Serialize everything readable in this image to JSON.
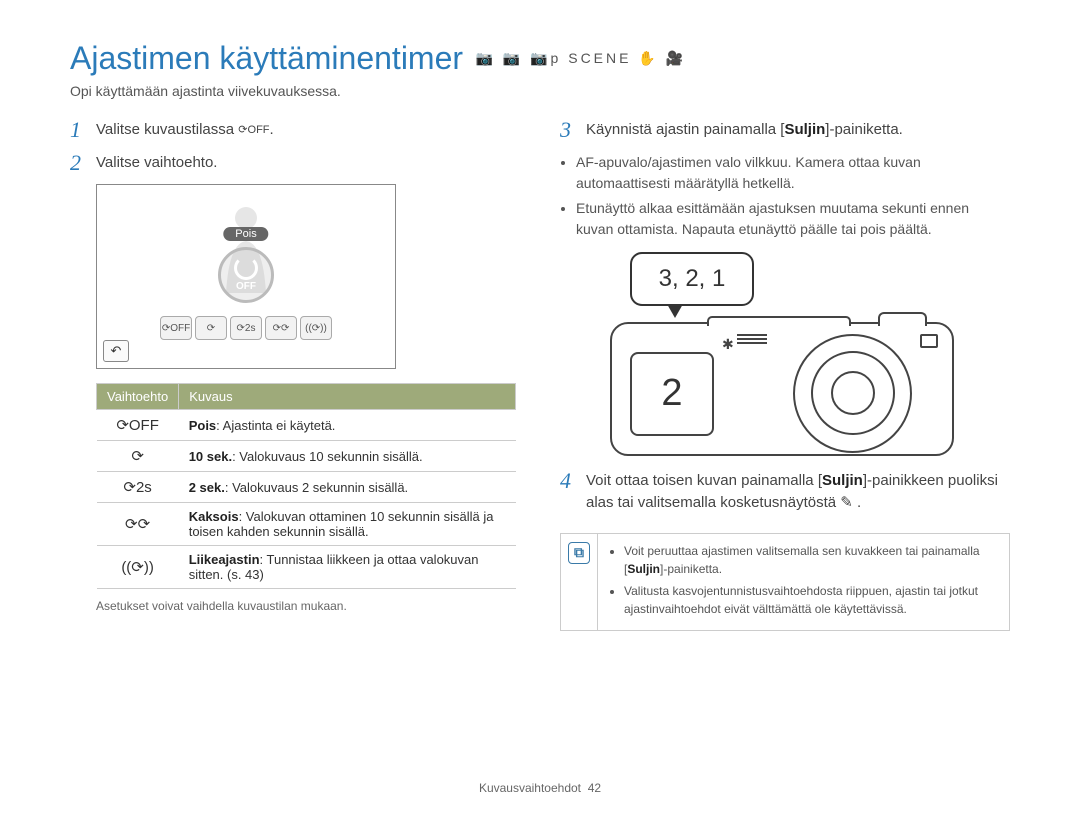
{
  "title": "Ajastimen käyttäminentimer",
  "mode_icons": "📷 📷 📷p SCENE ✋ 🎥",
  "subtitle": "Opi käyttämään ajastinta viivekuvauksessa.",
  "left": {
    "step1_num": "1",
    "step1_text_a": "Valitse kuvaustilassa ",
    "step1_text_b": ".",
    "step1_icon": "⟳OFF",
    "step2_num": "2",
    "step2_text": "Valitse vaihtoehto.",
    "screen": {
      "timer_label": "Pois",
      "options": [
        "⟳OFF",
        "⟳",
        "⟳2s",
        "⟳⟳",
        "((⟳))"
      ],
      "back": "↶"
    },
    "table": {
      "header_option": "Vaihtoehto",
      "header_desc": "Kuvaus",
      "rows": [
        {
          "icon": "⟳OFF",
          "bold": "Pois",
          "text": ": Ajastinta ei käytetä."
        },
        {
          "icon": "⟳",
          "bold": "10 sek.",
          "text": ": Valokuvaus 10 sekunnin sisällä."
        },
        {
          "icon": "⟳2s",
          "bold": "2 sek.",
          "text": ": Valokuvaus 2 sekunnin sisällä."
        },
        {
          "icon": "⟳⟳",
          "bold": "Kaksois",
          "text": ": Valokuvan ottaminen 10 sekunnin sisällä ja toisen kahden sekunnin sisällä."
        },
        {
          "icon": "((⟳))",
          "bold": "Liikeajastin",
          "text": ": Tunnistaa liikkeen ja ottaa valokuvan sitten. (s. 43)"
        }
      ]
    },
    "note": "Asetukset voivat vaihdella kuvaustilan mukaan."
  },
  "right": {
    "step3_num": "3",
    "step3_text_a": "Käynnistä ajastin painamalla [",
    "step3_text_b": "Suljin",
    "step3_text_c": "]-painiketta.",
    "bullets3": [
      "AF-apuvalo/ajastimen valo vilkkuu. Kamera ottaa kuvan automaattisesti määrätyllä hetkellä.",
      "Etunäyttö alkaa esittämään ajastuksen muutama sekunti ennen kuvan ottamista. Napauta etunäyttö päälle tai pois päältä."
    ],
    "bubble": "3, 2, 1",
    "front_screen_number": "2",
    "step4_num": "4",
    "step4_text_a": "Voit ottaa toisen kuvan painamalla [",
    "step4_text_b": "Suljin",
    "step4_text_c": "]-painikkeen puoliksi alas tai valitsemalla kosketusnäytöstä ",
    "step4_icon": "✎",
    "step4_text_d": " .",
    "tips": [
      {
        "a": "Voit peruuttaa ajastimen valitsemalla sen kuvakkeen tai painamalla [",
        "b": "Suljin",
        "c": "]-painiketta."
      },
      {
        "a": "Valitusta kasvojentunnistusvaihtoehdosta riippuen, ajastin tai jotkut ajastinvaihtoehdot eivät välttämättä ole käytettävissä.",
        "b": "",
        "c": ""
      }
    ]
  },
  "footer_label": "Kuvausvaihtoehdot",
  "footer_page": "42"
}
